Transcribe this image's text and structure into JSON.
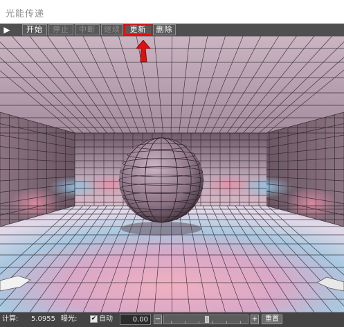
{
  "window": {
    "title": "光能传递"
  },
  "toolbar": {
    "play_icon": "▶",
    "buttons": [
      {
        "label": "开始",
        "enabled": true
      },
      {
        "label": "停止",
        "enabled": false
      },
      {
        "label": "中断",
        "enabled": false
      },
      {
        "label": "继续",
        "enabled": false
      },
      {
        "label": "更新",
        "enabled": true,
        "highlighted": true
      },
      {
        "label": "删除",
        "enabled": true
      }
    ]
  },
  "viewport": {
    "scene": "radiosity-rendered room with sphere and mesh grid",
    "colors": {
      "background": "#1a1a1a",
      "wall": "#d4c4d2",
      "floor_highlight": "#e6a8b8",
      "floor_blue": "#9fc4dc",
      "mesh_line": "#2a2a2a",
      "annotation_red": "#e01010"
    }
  },
  "status": {
    "calc_label": "计算:",
    "calc_value": "5.0955",
    "exposure_label": "曝光:",
    "auto_checked": true,
    "auto_label": "自动",
    "exposure_value": "0.00",
    "minus_label": "−",
    "plus_label": "+",
    "reset_label": "重置",
    "slider_value": 0.5
  }
}
